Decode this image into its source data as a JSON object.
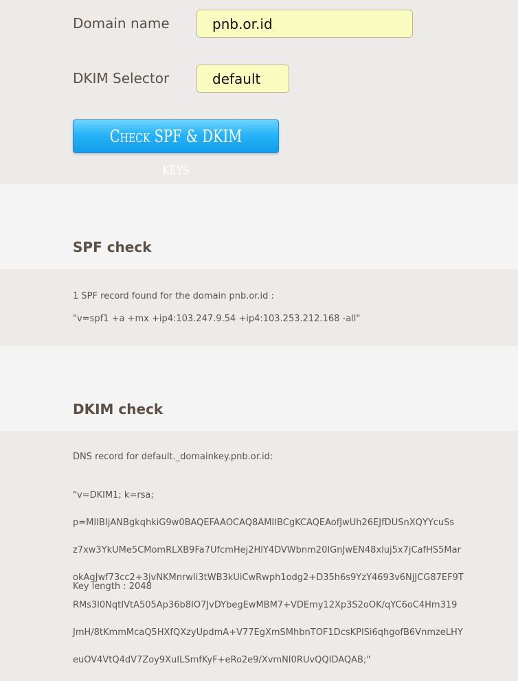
{
  "form": {
    "domain_label": "Domain name",
    "domain_value": "pnb.or.id",
    "selector_label": "DKIM Selector",
    "selector_value": "default",
    "check_button": "Check SPF & DKIM keys"
  },
  "spf": {
    "title": "SPF check",
    "summary": "1 SPF record found for the domain pnb.or.id :",
    "record": "\"v=spf1 +a +mx +ip4:103.247.9.54 +ip4:103.253.212.168 -all\""
  },
  "dkim": {
    "title": "DKIM check",
    "dns_label": "DNS record for default._domainkey.pnb.or.id:",
    "record_lines": [
      "\"v=DKIM1; k=rsa;",
      "p=MIIBIjANBgkqhkiG9w0BAQEFAAOCAQ8AMIIBCgKCAQEAofJwUh26EJfDUSnXQYYcuSs",
      "z7xw3YkUMe5CMomRLXB9Fa7UfcmHej2HlY4DVWbnm20IGnJwEN48xluj5x7jCafHS5Mar",
      "okAgJwf73cc2+3jvNKMnrwIi3tWB3kUiCwRwph1odg2+D35h6s9YzY4693v6NjJCG87EF9T",
      "RMs3l0NqtIVtA505Ap36b8IO7JvDYbegEwMBM7+VDEmy12Xp3S2oOK/qYC6oC4Hm319",
      "JmH/8tKmmMcaQ5HXfQXzyUpdmA+V77EgXmSMhbnTOF1DcsKPlSi6qhgofB6VnmzeLHY",
      "euOV4VtQ4dV7Zoy9XuILSmfKyF+eRo2e9/XvmNI0RUvQQIDAQAB;\""
    ],
    "key_length": "Key length : 2048"
  }
}
